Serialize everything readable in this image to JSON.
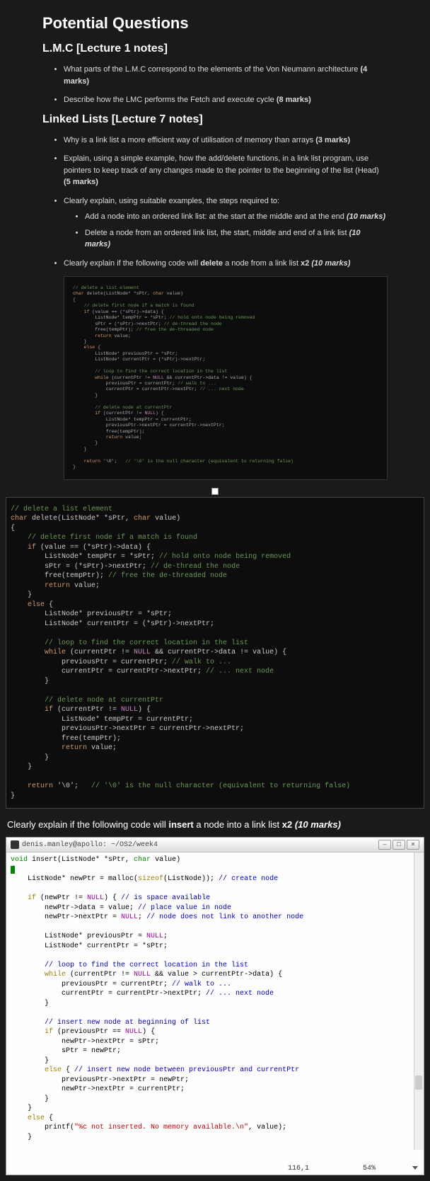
{
  "headings": {
    "main": "Potential Questions",
    "lmc": "L.M.C [Lecture 1 notes]",
    "linked": "Linked Lists [Lecture 7 notes]"
  },
  "lmc_items": [
    {
      "text": "What parts of the L.M.C correspond to the elements of the Von Neumann architecture ",
      "marks": "(4 marks)"
    },
    {
      "text": "Describe how the LMC performs the Fetch and execute cycle ",
      "marks": "(8 marks)"
    }
  ],
  "linked_items": [
    {
      "text": "Why is a link list a more efficient way of utilisation of memory than arrays ",
      "marks": "(3 marks)"
    },
    {
      "text": "Explain, using a simple example, how the add/delete functions, in a link list program, use pointers to keep track of any changes made to the pointer to the beginning of the list (Head) ",
      "marks": "(5 marks)"
    },
    {
      "text": "Clearly explain, using suitable examples, the steps required to:",
      "marks": ""
    }
  ],
  "sub_items": [
    {
      "text": "Add a node into an ordered link list: at the start at the middle and at the end ",
      "marks": "(10 marks)"
    },
    {
      "text": "Delete a node from an ordered link list, the start, middle and end of a link list ",
      "marks": "(10 marks)"
    }
  ],
  "delete_q": {
    "pre": "Clearly explain if the following code will ",
    "bold": "delete",
    "post": " a node from a link list ",
    "x2": "x2 ",
    "marks": "(10 marks)"
  },
  "insert_q": {
    "pre": "Clearly explain if the following code will ",
    "bold": "insert",
    "post": " a node into a link list ",
    "x2": "x2 ",
    "marks": "(10 marks)"
  },
  "terminal": {
    "title": "denis.manley@apollo: ~/OS2/week4",
    "pos": "116,1",
    "pct": "54%"
  },
  "code_delete": {
    "l01": "// delete a list element",
    "l02a": "char",
    "l02b": " delete(ListNode* *sPtr, ",
    "l02c": "char",
    "l02d": " value)",
    "l03": "{",
    "l04": "    // delete first node if a match is found",
    "l05a": "    if",
    "l05b": " (value == (*sPtr)->data) {",
    "l06a": "        ListNode* tempPtr = *sPtr; ",
    "l06b": "// hold onto node being removed",
    "l07a": "        sPtr = (*sPtr)->nextPtr; ",
    "l07b": "// de-thread the node",
    "l08a": "        free(tempPtr); ",
    "l08b": "// free the de-threaded node",
    "l09a": "        return",
    "l09b": " value;",
    "l10": "    }",
    "l11a": "    else",
    "l11b": " {",
    "l12": "        ListNode* previousPtr = *sPtr;",
    "l13": "        ListNode* currentPtr = (*sPtr)->nextPtr;",
    "l14": "",
    "l15": "        // loop to find the correct location in the list",
    "l16a": "        while",
    "l16b": " (currentPtr != ",
    "l16c": "NULL",
    "l16d": " && currentPtr->data != value) {",
    "l17a": "            previousPtr = currentPtr; ",
    "l17b": "// walk to ...",
    "l18a": "            currentPtr = currentPtr->nextPtr; ",
    "l18b": "// ... next node",
    "l19": "        }",
    "l20": "",
    "l21": "        // delete node at currentPtr",
    "l22a": "        if",
    "l22b": " (currentPtr != ",
    "l22c": "NULL",
    "l22d": ") {",
    "l23": "            ListNode* tempPtr = currentPtr;",
    "l24": "            previousPtr->nextPtr = currentPtr->nextPtr;",
    "l25": "            free(tempPtr);",
    "l26a": "            return",
    "l26b": " value;",
    "l27": "        }",
    "l28": "    }",
    "l29": "",
    "l30a": "    return",
    "l30b": " '\\0';   ",
    "l30c": "// '\\0' is the null character (equivalent to returning false)",
    "l31": "}"
  },
  "code_insert": {
    "l01a": "void",
    "l01b": " insert(ListNode* *sPtr, ",
    "l01c": "char",
    "l01d": " value)",
    "l02": "{",
    "l03a": "    ListNode* newPtr = malloc(",
    "l03b": "sizeof",
    "l03c": "(ListNode)); ",
    "l03d": "// create node",
    "l04": "",
    "l05a": "    if",
    "l05b": " (newPtr != ",
    "l05c": "NULL",
    "l05d": ") { ",
    "l05e": "// is space available",
    "l06a": "        newPtr->data = value; ",
    "l06b": "// place value in node",
    "l07a": "        newPtr->nextPtr = ",
    "l07b": "NULL",
    "l07c": "; ",
    "l07d": "// node does not link to another node",
    "l08": "",
    "l09a": "        ListNode* previousPtr = ",
    "l09b": "NULL",
    "l09c": ";",
    "l10": "        ListNode* currentPtr = *sPtr;",
    "l11": "",
    "l12": "        // loop to find the correct location in the list",
    "l13a": "        while",
    "l13b": " (currentPtr != ",
    "l13c": "NULL",
    "l13d": " && value > currentPtr->data) {",
    "l14a": "            previousPtr = currentPtr; ",
    "l14b": "// walk to ...",
    "l15a": "            currentPtr = currentPtr->nextPtr; ",
    "l15b": "// ... next node",
    "l16": "        }",
    "l17": "",
    "l18": "        // insert new node at beginning of list",
    "l19a": "        if",
    "l19b": " (previousPtr == ",
    "l19c": "NULL",
    "l19d": ") {",
    "l20": "            newPtr->nextPtr = sPtr;",
    "l21": "            sPtr = newPtr;",
    "l22": "        }",
    "l23a": "        else",
    "l23b": " { ",
    "l23c": "// insert new node between previousPtr and currentPtr",
    "l24": "            previousPtr->nextPtr = newPtr;",
    "l25": "            newPtr->nextPtr = currentPtr;",
    "l26": "        }",
    "l27": "    }",
    "l28a": "    else",
    "l28b": " {",
    "l29a": "        printf(",
    "l29b": "\"%c not inserted. No memory available.\\n\"",
    "l29c": ", value);",
    "l30": "    }"
  }
}
